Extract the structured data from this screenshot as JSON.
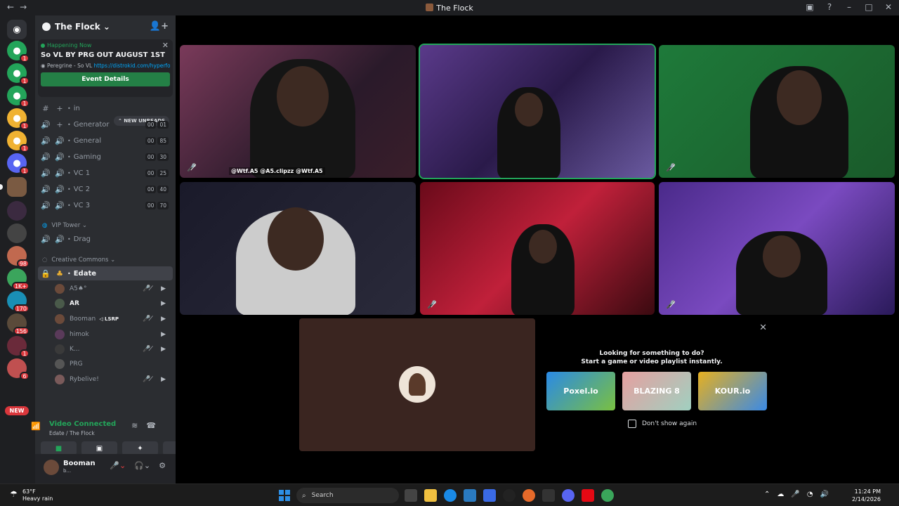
{
  "window": {
    "title": "The Flock",
    "nav_back": "←",
    "nav_fwd": "→"
  },
  "server_badges": [
    {
      "badge": "1"
    },
    {
      "badge": "1"
    },
    {
      "badge": "1"
    },
    {
      "badge": "1"
    },
    {
      "badge": "1"
    },
    {
      "badge": "1"
    },
    {
      "badge": ""
    },
    {
      "badge": ""
    },
    {
      "badge": ""
    },
    {
      "badge": "98"
    },
    {
      "badge": "1K+"
    },
    {
      "badge": "170"
    },
    {
      "badge": "156"
    },
    {
      "badge": "1"
    },
    {
      "badge": "6"
    }
  ],
  "server_new": "NEW",
  "guild": {
    "name": "The Flock ⌄"
  },
  "event": {
    "status": "Happening Now",
    "title": "So VL BY PRG OUT AUGUST 1ST",
    "location_prefix": "Peregrine - So VL ",
    "location_link": "https://distrokid.com/hyperfo...",
    "button": "Event Details"
  },
  "new_unreads": "⌃ NEW UNREADS",
  "channels": [
    {
      "name": "in",
      "i1": "#",
      "i2": "+",
      "counts": []
    },
    {
      "name": "Generator",
      "i1": "🔊",
      "i2": "+",
      "counts": [
        "00",
        "01"
      ]
    },
    {
      "name": "General",
      "i1": "🔊",
      "i2": "🔊",
      "counts": [
        "00",
        "85"
      ]
    },
    {
      "name": "Gaming",
      "i1": "🔊",
      "i2": "🔊",
      "counts": [
        "00",
        "30"
      ]
    },
    {
      "name": "VC 1",
      "i1": "🔊",
      "i2": "🔊",
      "counts": [
        "00",
        "25"
      ]
    },
    {
      "name": "VC 2",
      "i1": "🔊",
      "i2": "🔊",
      "counts": [
        "00",
        "40"
      ]
    },
    {
      "name": "VC 3",
      "i1": "🔊",
      "i2": "🔊",
      "counts": [
        "00",
        "70"
      ]
    }
  ],
  "categories": {
    "vip": "VIP Tower ⌄",
    "creative": "Creative Commons ⌄"
  },
  "drag_channel": "Drag",
  "active_channel": "Edate",
  "voice_users": [
    {
      "name": "A5♠°",
      "tag": "",
      "icons": "🎤̸ ▶"
    },
    {
      "name": "AR",
      "tag": "",
      "icons": "▶"
    },
    {
      "name": "Booman",
      "tag": "◁ LSRP",
      "icons": "🎤̸ ▶"
    },
    {
      "name": "himok",
      "tag": "",
      "icons": "▶"
    },
    {
      "name": "K...",
      "tag": "",
      "icons": "🎤̸ ▶"
    },
    {
      "name": "PRG",
      "tag": "",
      "icons": ""
    },
    {
      "name": "Rybelive!",
      "tag": "",
      "icons": "🎤̸ ▶"
    }
  ],
  "voice_panel": {
    "status": "Video Connected",
    "sub": "Edate / The Flock"
  },
  "user": {
    "name": "Booman",
    "sub": "b..."
  },
  "tile_overlay": "@Wtf.A5 @A5.clipzz @Wtf.A5",
  "activity": {
    "line1": "Looking for something to do?",
    "line2": "Start a game or video playlist instantly.",
    "games": [
      "Poxel.io",
      "BLAZING 8",
      "KOUR.io"
    ],
    "dont_show": "Don't show again"
  },
  "taskbar": {
    "temp": "63°F",
    "weather": "Heavy rain",
    "search": "Search",
    "time": "11:24 PM",
    "date": "2/14/2026"
  },
  "colors": {
    "accent_green": "#23a55a",
    "danger": "#da373c",
    "blurple": "#5865f2"
  }
}
